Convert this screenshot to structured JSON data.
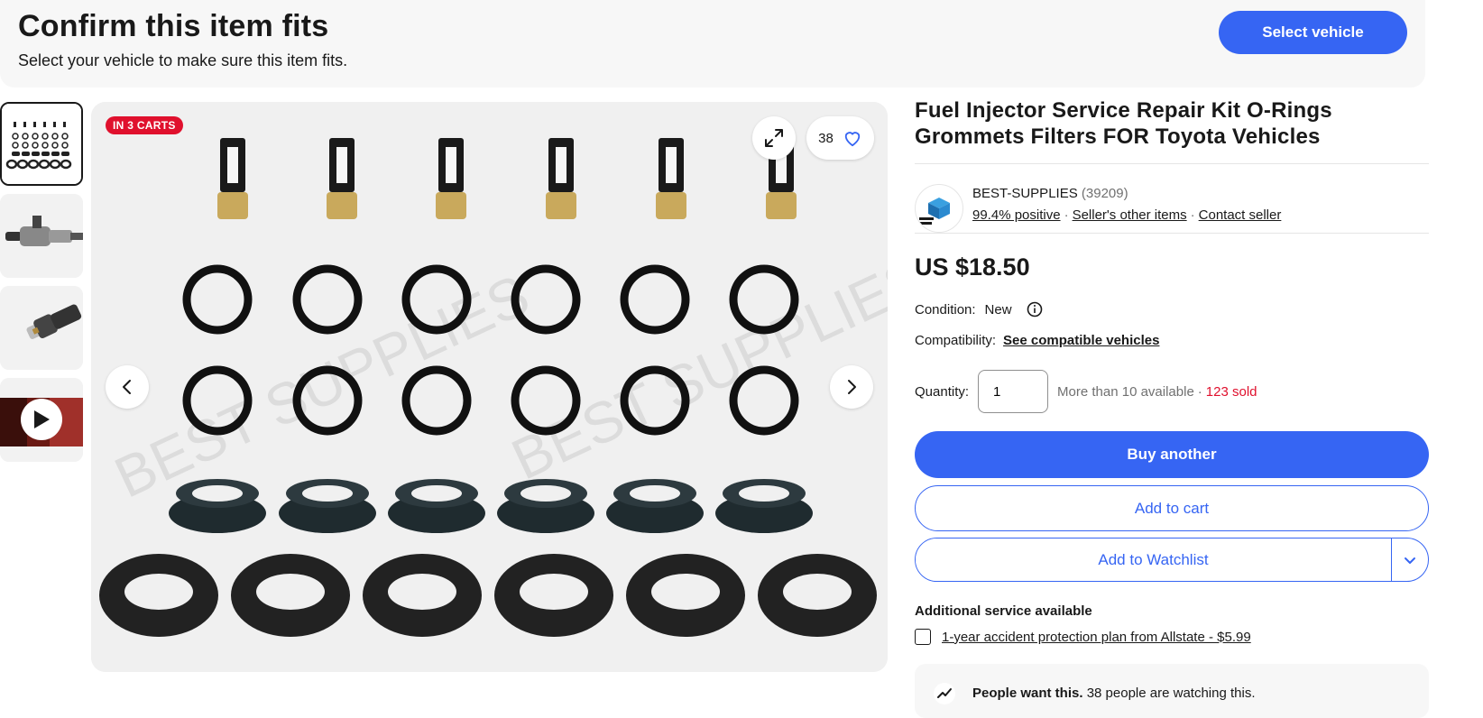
{
  "fitment": {
    "title": "Confirm this item fits",
    "subtitle": "Select your vehicle to make sure this item fits.",
    "select_button": "Select vehicle"
  },
  "gallery": {
    "badge": "IN 3 CARTS",
    "watch_count": "38",
    "thumbnails": [
      "kit-parts",
      "injector-side",
      "injector-angle",
      "video"
    ]
  },
  "product": {
    "title": "Fuel Injector Service Repair Kit O-Rings Grommets Filters FOR Toyota Vehicles",
    "price": "US $18.50",
    "condition_label": "Condition:",
    "condition_value": "New",
    "compat_label": "Compatibility:",
    "compat_link": "See compatible vehicles",
    "quantity_label": "Quantity:",
    "quantity_value": "1",
    "availability": "More than 10 available",
    "sold": "123 sold"
  },
  "seller": {
    "name": "BEST-SUPPLIES",
    "count": "(39209)",
    "positive": "99.4% positive",
    "other_items": "Seller's other items",
    "contact": "Contact seller"
  },
  "actions": {
    "buy": "Buy another",
    "cart": "Add to cart",
    "watchlist": "Add to Watchlist"
  },
  "service": {
    "heading": "Additional service available",
    "plan": "1-year accident protection plan from Allstate - $5.99"
  },
  "watchers": {
    "bold": "People want this.",
    "text": "38 people are watching this."
  },
  "colors": {
    "primary": "#3665f3",
    "badge": "#e0102d",
    "text": "#191919"
  }
}
